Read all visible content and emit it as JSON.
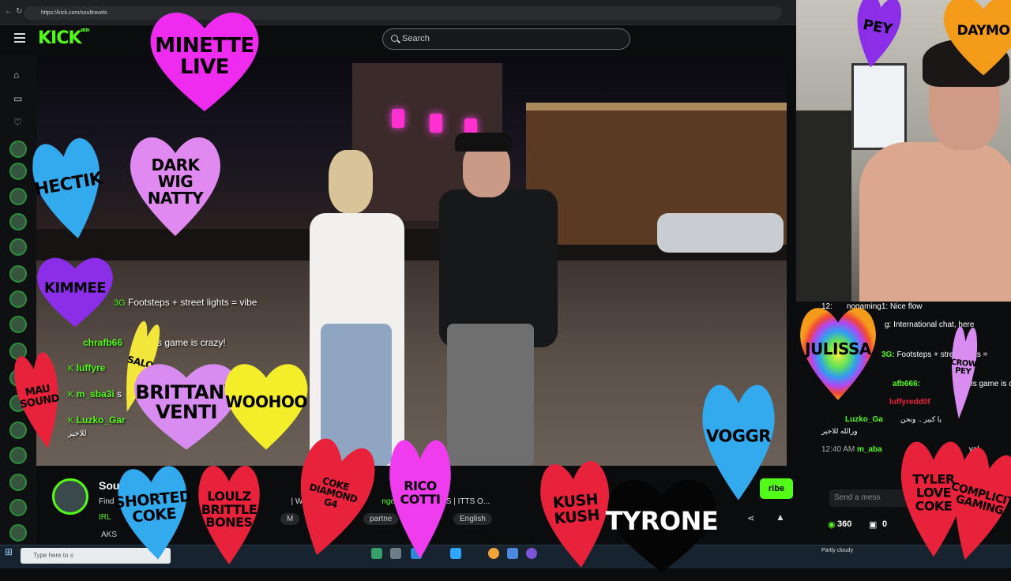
{
  "browser": {
    "url": "https://kick.com/soultravels"
  },
  "header": {
    "logo": "KICK",
    "logo_badge": "BETA",
    "search_placeholder": "Search"
  },
  "stream_overlay_chat": [
    {
      "user": "",
      "badge": "3G",
      "text": "Footsteps + street lights = vibe"
    },
    {
      "user": "chrafb66",
      "badge": "",
      "text": "This game is crazy!"
    },
    {
      "user": "luffyre",
      "badge": "K",
      "text": ""
    },
    {
      "user": "m_sba3i",
      "badge": "K",
      "text": "s"
    },
    {
      "user": "Luzko_Gar",
      "badge": "K",
      "text": ""
    }
  ],
  "overlay_arabic": "للاخير",
  "channel": {
    "name": "Sou",
    "title_left": "Find",
    "title_mid": "| W",
    "title_right": "STIN TEXAS | ITTS O...",
    "title_anger": "nger",
    "category": "IRL",
    "tags": [
      "M",
      "partne",
      "English"
    ],
    "subscribe_label": "ribe",
    "ticker": "AKS"
  },
  "chat": {
    "lines": [
      {
        "time": "12:",
        "user": "",
        "text": "nogaming1: Nice flow"
      },
      {
        "time": "",
        "user": "",
        "text": "g: International chat, here"
      },
      {
        "time": "",
        "user": "3G:",
        "text": "Footsteps + street lights ="
      },
      {
        "time": "",
        "user": "",
        "text": "is"
      },
      {
        "time": "",
        "user": "afb666:",
        "text": "This game is crazy!"
      },
      {
        "time": "",
        "user": "luffyredd0f",
        "text": ""
      },
      {
        "time": "",
        "user": "",
        "text": "يا كبير .. ونحن"
      },
      {
        "time": "",
        "user": "",
        "text": "ورالله للاخير"
      },
      {
        "time": "",
        "user": "Luzko_Ga",
        "text": ""
      },
      {
        "time": "12:40 AM",
        "user": "m_aba",
        "text": "yal"
      }
    ],
    "input_placeholder": "Send a mess",
    "viewer_count": "360",
    "gift_count": "0"
  },
  "taskbar": {
    "search_placeholder": "Type here to s",
    "weather": "Partly cloudy"
  },
  "overlay_hearts": [
    {
      "label": "MINETTE\nLIVE",
      "color": "#ee2bee"
    },
    {
      "label": "DARK\nWIG\nNATTY",
      "color": "#e089f0"
    },
    {
      "label": "HECTIK",
      "color": "#33aaee"
    },
    {
      "label": "KIMMEE",
      "color": "#8a2ee8"
    },
    {
      "label": "MAU\nSOUND",
      "color": "#e8223a"
    },
    {
      "label": "SALO",
      "color": "#f2e63a"
    },
    {
      "label": "BRITTANY\nVENTI",
      "color": "#d88cf0"
    },
    {
      "label": "WOOHOO",
      "color": "#f4ee2a"
    },
    {
      "label": "SHORTED\nCOKE",
      "color": "#33aaee"
    },
    {
      "label": "LOULZ\nBRITTLE\nBONES",
      "color": "#e8223a"
    },
    {
      "label": "COKE\nDIAMOND\nG4",
      "color": "#e8223a"
    },
    {
      "label": "RICO\nCOTTI",
      "color": "#ee3cee"
    },
    {
      "label": "KUSH\nKUSH",
      "color": "#e8223a"
    },
    {
      "label": "TYRONE",
      "color": "#050505"
    },
    {
      "label": "VOGGR",
      "color": "#33aaee"
    },
    {
      "label": "JULISSA",
      "color": "rainbow"
    },
    {
      "label": "PEY",
      "color": "#8a2ee8"
    },
    {
      "label": "DAYMO",
      "color": "#f59b1a"
    },
    {
      "label": "TYLER\nLOVE\nCOKE",
      "color": "#e8223a"
    },
    {
      "label": "COMPLICIT\nGAMING",
      "color": "#e8223a"
    },
    {
      "label": "CROW\nPEY",
      "color": "#d88cf0"
    }
  ],
  "colors": {
    "accent": "#53fc18",
    "background": "#0b0c0e"
  }
}
